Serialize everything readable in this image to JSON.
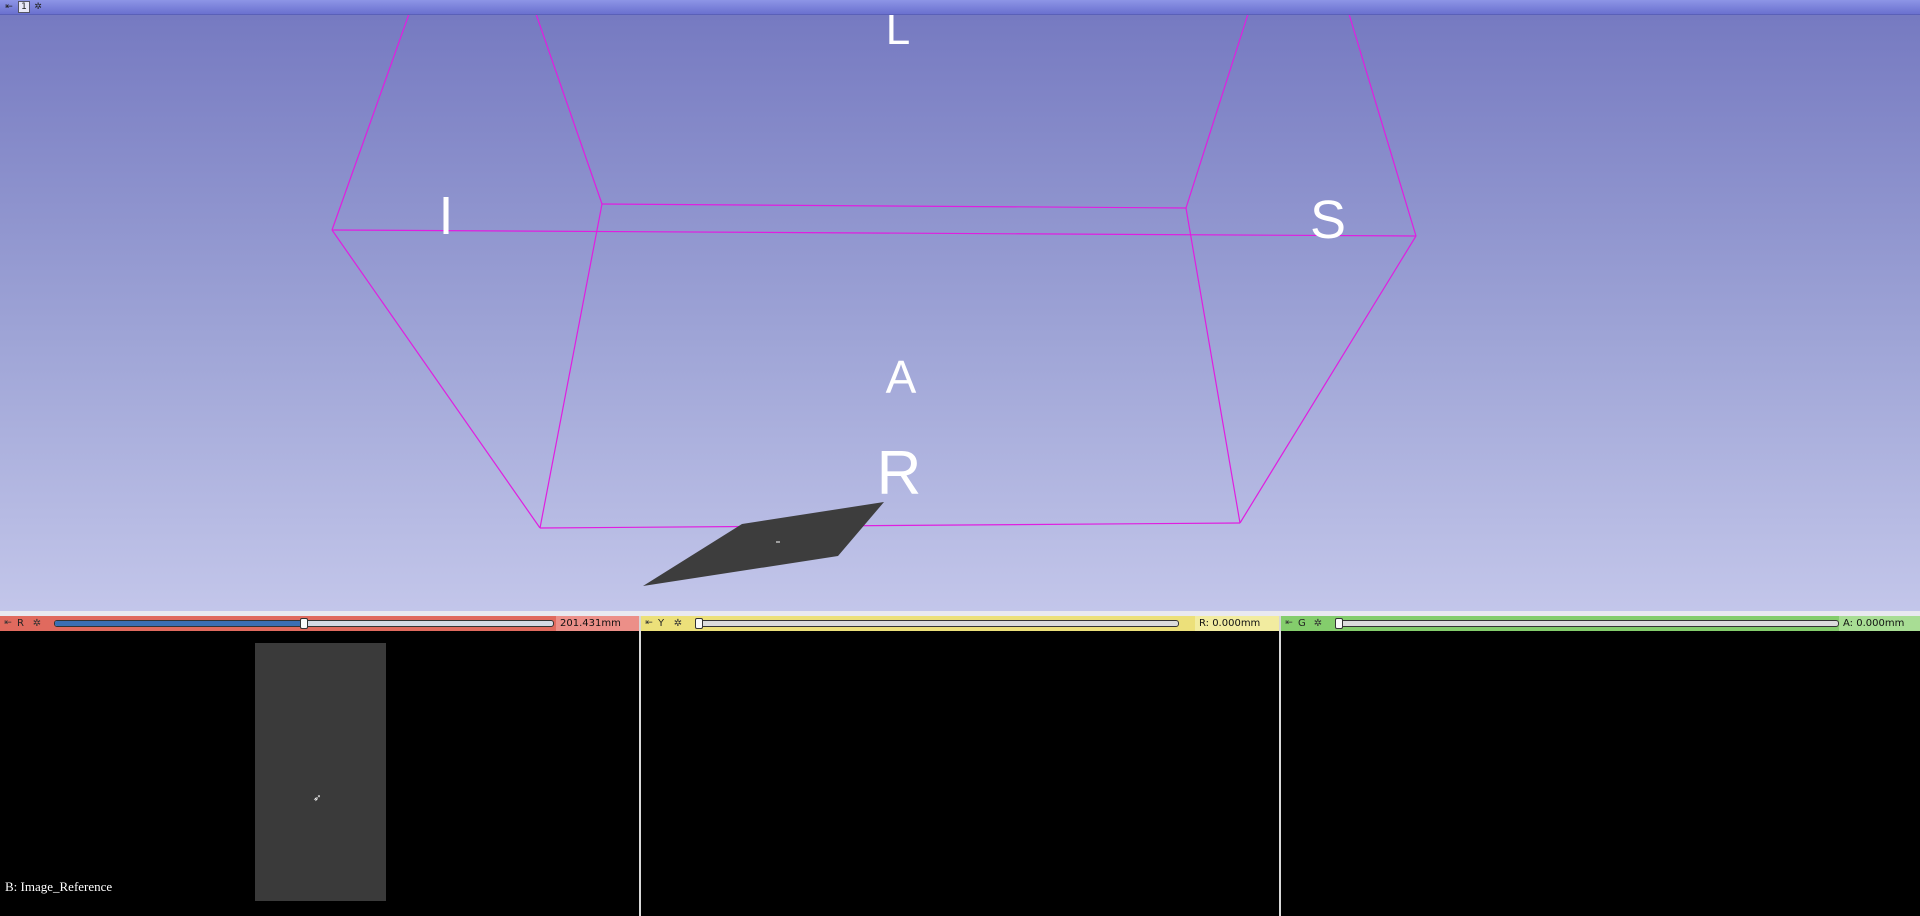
{
  "viewer3d": {
    "view_number": "1",
    "pin_icon": "pin-icon",
    "settings_icon": "gear-icon",
    "background_top": "#7478c0",
    "background_bottom": "#c3c6ea",
    "bounding_box_color": "#e01ee0",
    "orientation_labels": {
      "top": "L",
      "left": "I",
      "right": "S",
      "center": "A",
      "bottom": "R"
    }
  },
  "slices": [
    {
      "id": "red",
      "letter": "R",
      "color": "#e06a5e",
      "offset": "201.431mm",
      "slider_fraction": 0.5,
      "layer_label": "B: Image_Reference"
    },
    {
      "id": "yellow",
      "letter": "Y",
      "color": "#ece07a",
      "offset": "R: 0.000mm",
      "slider_fraction": 0.0
    },
    {
      "id": "green",
      "letter": "G",
      "color": "#84cd6c",
      "offset": "A: 0.000mm",
      "slider_fraction": 0.0
    }
  ]
}
